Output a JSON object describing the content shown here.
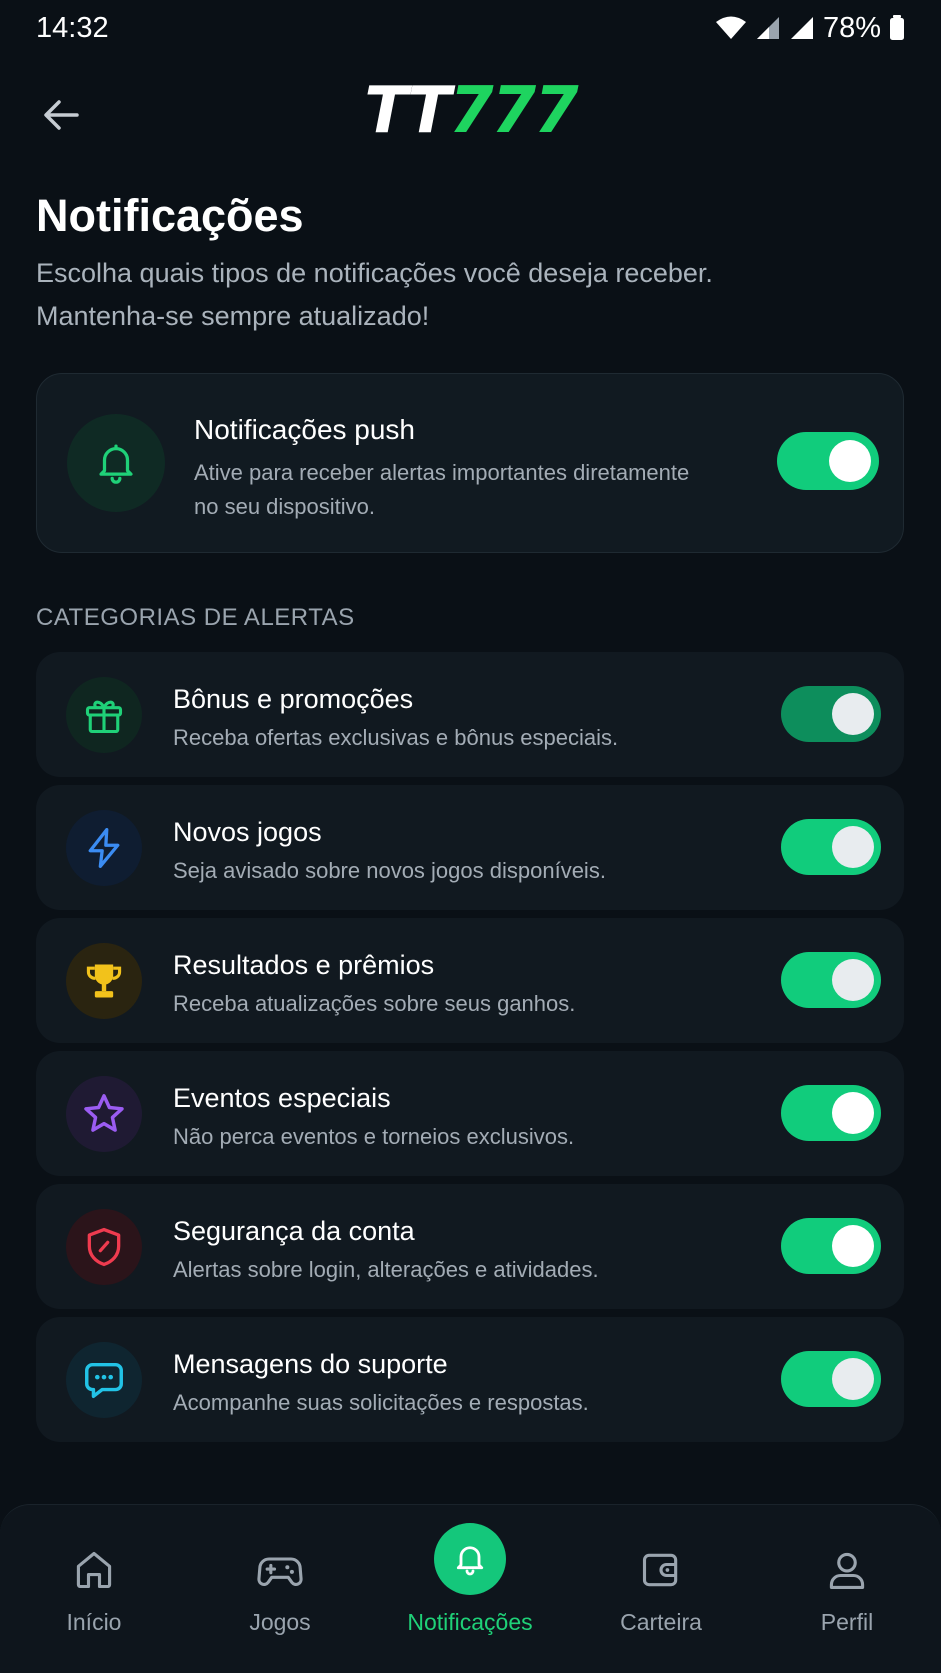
{
  "status_bar": {
    "time": "14:32",
    "battery": "78%"
  },
  "header": {
    "logo_prefix": "TT",
    "logo_number": "777"
  },
  "page": {
    "title": "Notificações",
    "subtitle": "Escolha quais tipos de notificações você deseja receber. Mantenha-se sempre atualizado!"
  },
  "push": {
    "title": "Notificações push",
    "description": "Ative para receber alertas importantes diretamente no seu dispositivo.",
    "enabled": true
  },
  "section_label": "CATEGORIAS DE ALERTAS",
  "alerts": [
    {
      "title": "Bônus e promoções",
      "description": "Receba ofertas exclusivas e bônus especiais.",
      "icon": "gift-icon",
      "color": "#1fd178",
      "enabled": true
    },
    {
      "title": "Novos jogos",
      "description": "Seja avisado sobre novos jogos disponíveis.",
      "icon": "lightning-icon",
      "color": "#3b8cf2",
      "enabled": true
    },
    {
      "title": "Resultados e prêmios",
      "description": "Receba atualizações sobre seus ganhos.",
      "icon": "trophy-icon",
      "color": "#f2c21b",
      "enabled": true
    },
    {
      "title": "Eventos especiais",
      "description": "Não perca eventos e torneios exclusivos.",
      "icon": "star-icon",
      "color": "#9b5cf2",
      "enabled": true
    },
    {
      "title": "Segurança da conta",
      "description": "Alertas sobre login, alterações e atividades.",
      "icon": "shield-icon",
      "color": "#ef3b4f",
      "enabled": true
    },
    {
      "title": "Mensagens do suporte",
      "description": "Acompanhe suas solicitações e respostas.",
      "icon": "chat-icon",
      "color": "#22c3e6",
      "enabled": true
    }
  ],
  "nav": [
    {
      "label": "Início",
      "icon": "home-icon"
    },
    {
      "label": "Jogos",
      "icon": "gamepad-icon"
    },
    {
      "label": "Notificações",
      "icon": "bell-icon",
      "active": true
    },
    {
      "label": "Carteira",
      "icon": "wallet-icon"
    },
    {
      "label": "Perfil",
      "icon": "user-icon"
    }
  ],
  "colors": {
    "accent": "#14c77b",
    "background": "#0a1016",
    "card": "#111920"
  }
}
